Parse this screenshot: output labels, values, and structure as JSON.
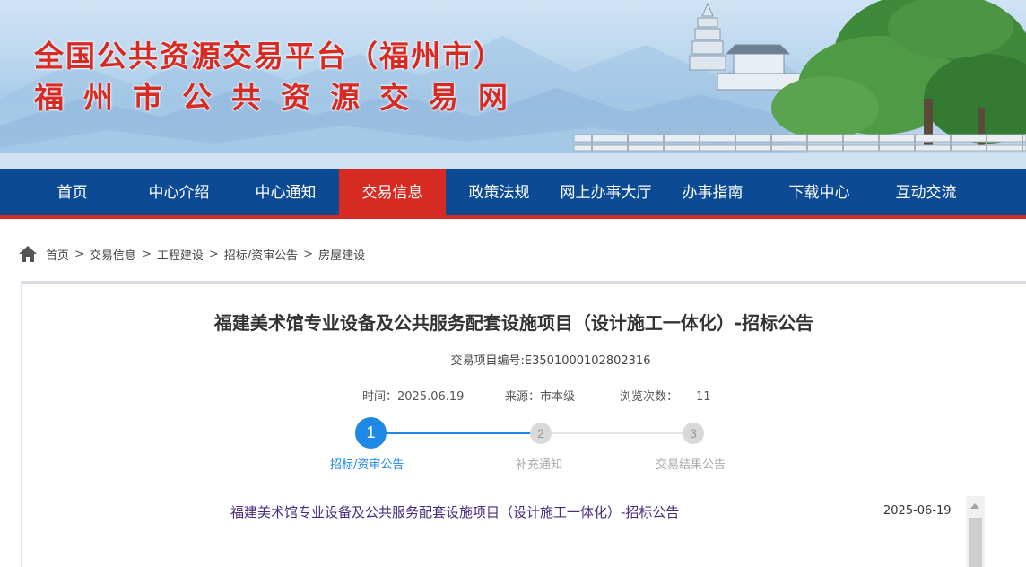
{
  "banner": {
    "title": "全国公共资源交易平台（福州市）",
    "subtitle": "福州市公共资源交易网"
  },
  "nav": {
    "items": [
      "首页",
      "中心介绍",
      "中心通知",
      "交易信息",
      "政策法规",
      "网上办事大厅",
      "办事指南",
      "下载中心",
      "互动交流"
    ],
    "active_index": 3
  },
  "breadcrumb": {
    "items": [
      "首页",
      "交易信息",
      "工程建设",
      "招标/资审公告",
      "房屋建设"
    ],
    "separator": ">"
  },
  "article": {
    "title": "福建美术馆专业设备及公共服务配套设施项目（设计施工一体化）-招标公告",
    "project_code": "交易项目编号:E3501000102802316",
    "time_label": "时间：",
    "time_value": "2025.06.19",
    "source_label": "来源：",
    "source_value": "市本级",
    "views_label": "浏览次数：",
    "views_value": "11"
  },
  "steps": [
    {
      "number": "1",
      "label": "招标/资审公告",
      "active": true
    },
    {
      "number": "2",
      "label": "补充通知",
      "active": false
    },
    {
      "number": "3",
      "label": "交易结果公告",
      "active": false
    }
  ],
  "list": [
    {
      "title": "福建美术馆专业设备及公共服务配套设施项目（设计施工一体化）-招标公告",
      "date": "2025-06-19"
    }
  ],
  "colors": {
    "brand_red": "#d62a22",
    "nav_blue": "#0d4a94",
    "step_active": "#1e88e5",
    "step_inactive": "#d9d9d9",
    "link_purple": "#4a2a7a"
  },
  "icons": {
    "home": "home-icon",
    "scroll_up": "scroll-up-arrow-icon"
  }
}
